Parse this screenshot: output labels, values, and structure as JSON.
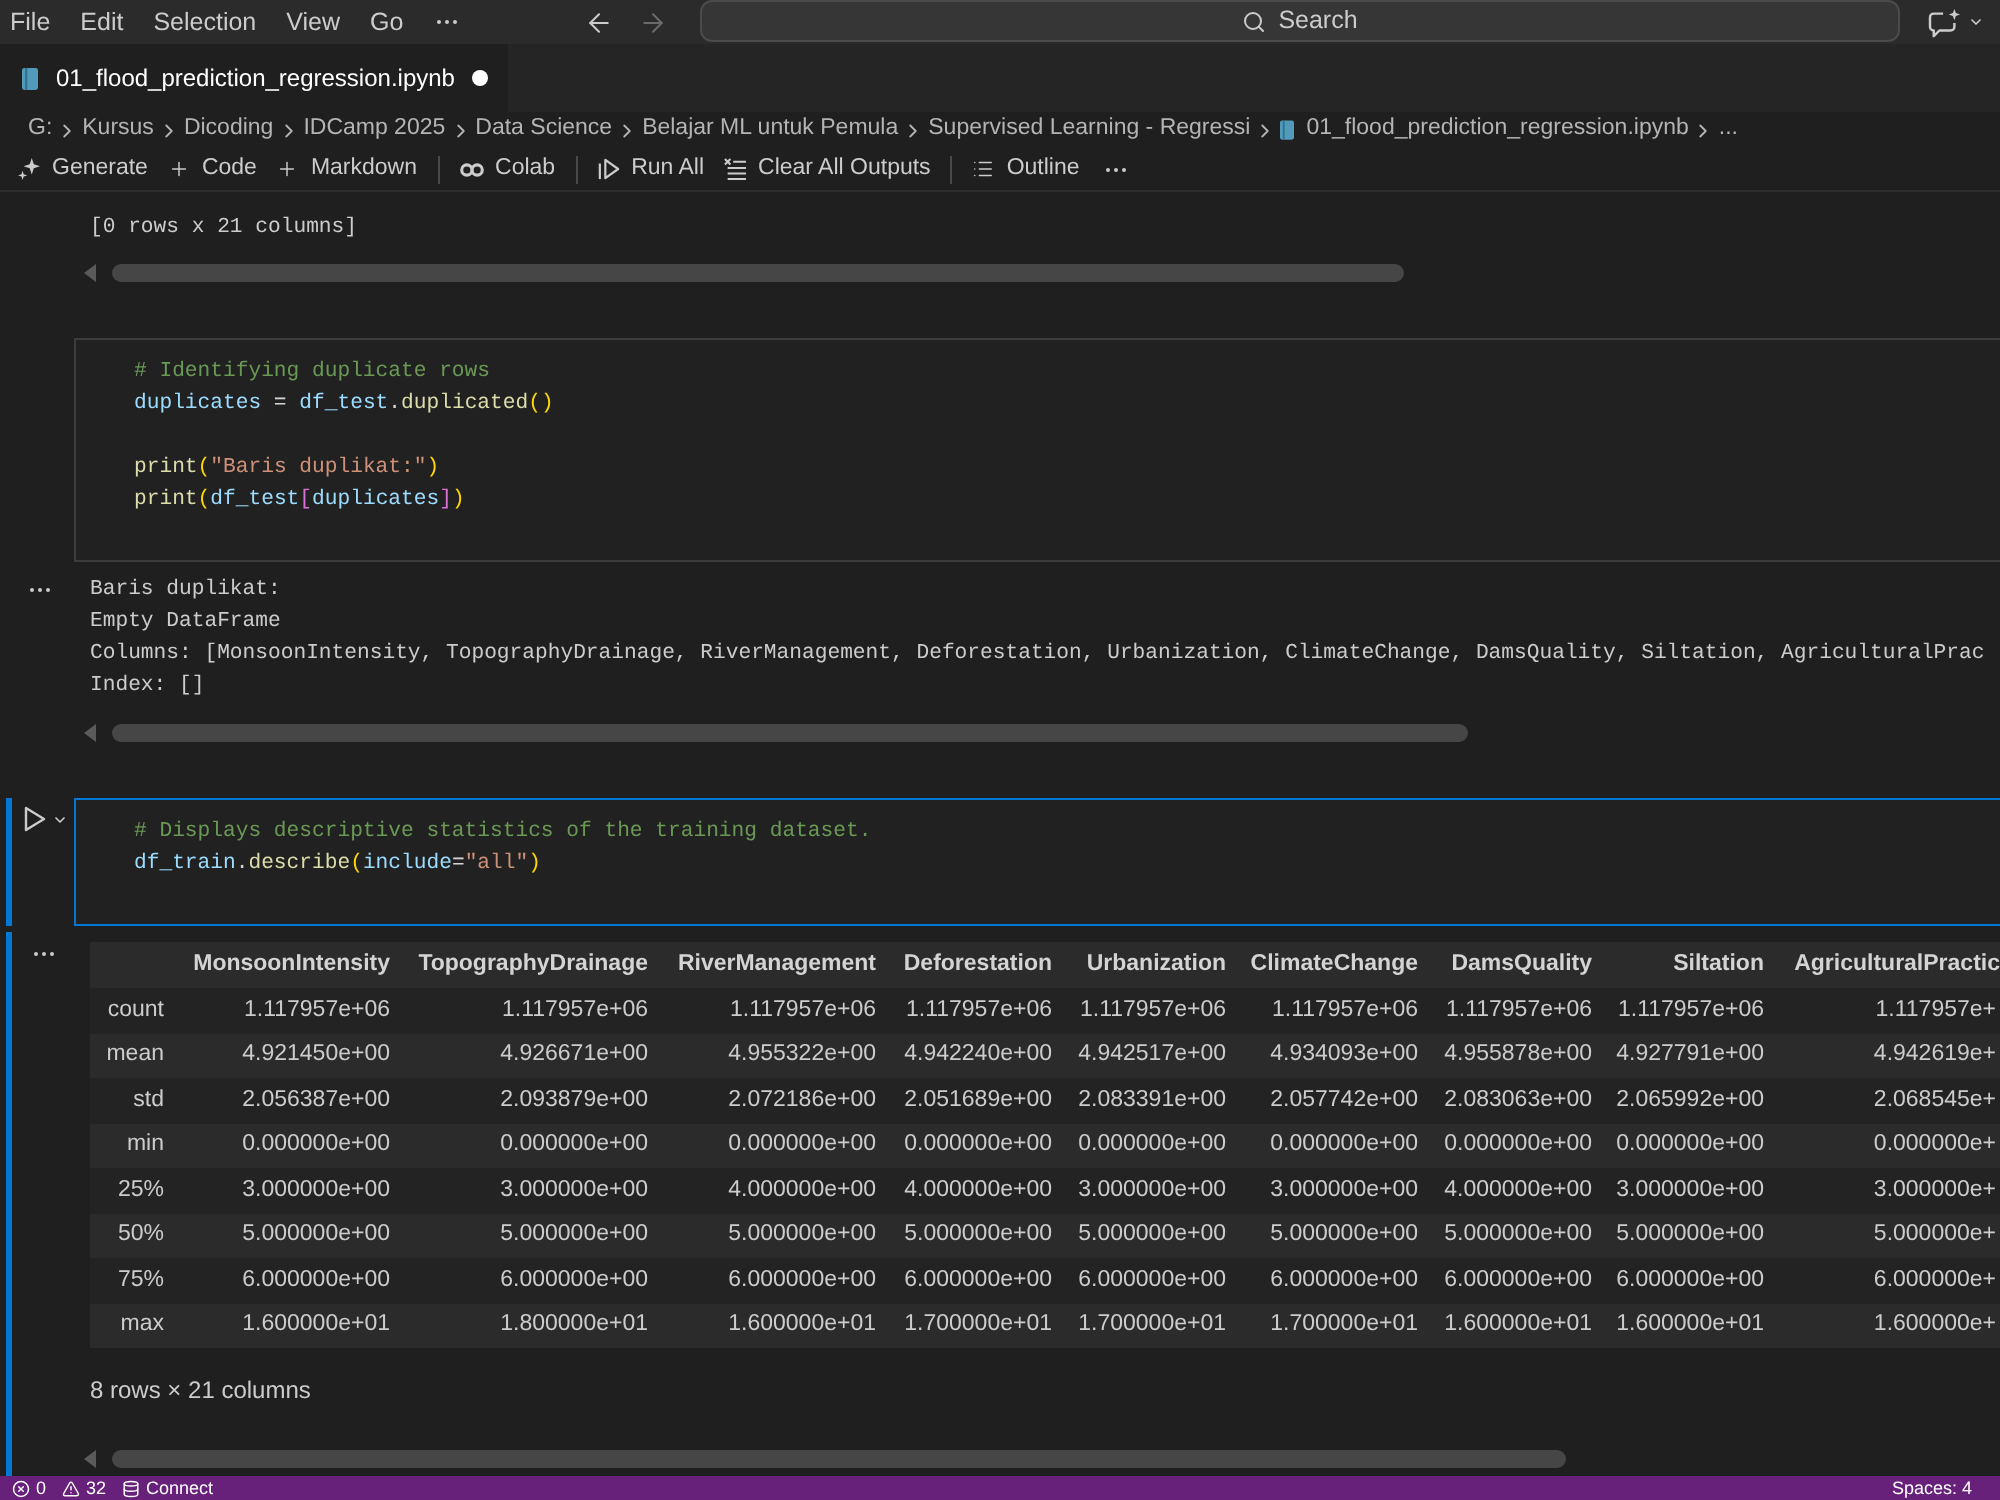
{
  "menubar": {
    "items": [
      "File",
      "Edit",
      "Selection",
      "View",
      "Go"
    ],
    "nav": [
      {
        "kind": "back",
        "disabled": false
      },
      {
        "kind": "forward",
        "disabled": true
      }
    ],
    "search": {
      "placeholder": "Search"
    }
  },
  "tabs": [
    {
      "title": "01_flood_prediction_regression.ipynb",
      "selected": true,
      "modified": true
    }
  ],
  "breadcrumb": [
    {
      "label": "G:",
      "kind": "path"
    },
    {
      "label": "Kursus",
      "kind": "path"
    },
    {
      "label": "Dicoding",
      "kind": "path"
    },
    {
      "label": "IDCamp 2025",
      "kind": "path"
    },
    {
      "label": "Data Science",
      "kind": "path"
    },
    {
      "label": "Belajar ML untuk Pemula",
      "kind": "path"
    },
    {
      "label": "Supervised Learning - Regressi",
      "kind": "path"
    },
    {
      "label": "01_flood_prediction_regression.ipynb",
      "kind": "file"
    },
    {
      "label": "...",
      "kind": "more"
    }
  ],
  "toolbar": [
    {
      "label": "Generate",
      "kind": "generate"
    },
    {
      "label": "Code",
      "kind": "add"
    },
    {
      "label": "Markdown",
      "kind": "add"
    },
    {
      "kind": "separator"
    },
    {
      "label": "Colab",
      "kind": "colab"
    },
    {
      "kind": "separator"
    },
    {
      "label": "Run All",
      "kind": "run_all"
    },
    {
      "label": "Clear All Outputs",
      "kind": "clear"
    },
    {
      "kind": "separator"
    },
    {
      "label": "Outline",
      "kind": "outline"
    },
    {
      "kind": "more"
    }
  ],
  "notebook": {
    "previous_output": [
      "[0 rows x 21 columns]"
    ],
    "cells": [
      {
        "selected": false,
        "code": [
          {
            "kind": "code",
            "tokens": [
              {
                "kind": "comment",
                "text": "# Identifying duplicate rows"
              }
            ]
          },
          {
            "kind": "code",
            "tokens": [
              {
                "kind": "variable",
                "text": "duplicates"
              },
              {
                "kind": "operator",
                "text": " = "
              },
              {
                "kind": "variable",
                "text": "df_test"
              },
              {
                "kind": "operator",
                "text": "."
              },
              {
                "kind": "function",
                "text": "duplicated"
              },
              {
                "kind": "paren",
                "text": "()"
              }
            ]
          },
          {
            "kind": "blank"
          },
          {
            "kind": "code",
            "tokens": [
              {
                "kind": "function",
                "text": "print"
              },
              {
                "kind": "paren",
                "text": "("
              },
              {
                "kind": "string",
                "text": "\"Baris duplikat:\""
              },
              {
                "kind": "paren",
                "text": ")"
              }
            ]
          },
          {
            "kind": "code",
            "tokens": [
              {
                "kind": "function",
                "text": "print"
              },
              {
                "kind": "paren",
                "text": "("
              },
              {
                "kind": "variable",
                "text": "df_test"
              },
              {
                "kind": "bracket",
                "text": "["
              },
              {
                "kind": "variable",
                "text": "duplicates"
              },
              {
                "kind": "bracket",
                "text": "]"
              },
              {
                "kind": "paren",
                "text": ")"
              }
            ]
          }
        ],
        "output": {
          "kind": "text",
          "lines": [
            "Baris duplikat:",
            "Empty DataFrame",
            "Columns: [MonsoonIntensity, TopographyDrainage, RiverManagement, Deforestation, Urbanization, ClimateChange, DamsQuality, Siltation, AgriculturalPrac",
            "Index: []"
          ]
        }
      },
      {
        "selected": true,
        "code": [
          {
            "kind": "code",
            "tokens": [
              {
                "kind": "comment",
                "text": "# Displays descriptive statistics of the training dataset."
              }
            ]
          },
          {
            "kind": "code",
            "tokens": [
              {
                "kind": "variable",
                "text": "df_train"
              },
              {
                "kind": "operator",
                "text": "."
              },
              {
                "kind": "function",
                "text": "describe"
              },
              {
                "kind": "paren",
                "text": "("
              },
              {
                "kind": "variable",
                "text": "include"
              },
              {
                "kind": "operator",
                "text": "="
              },
              {
                "kind": "string",
                "text": "\"all\""
              },
              {
                "kind": "paren",
                "text": ")"
              }
            ]
          }
        ],
        "output": {
          "kind": "table",
          "columns": [
            "MonsoonIntensity",
            "TopographyDrainage",
            "RiverManagement",
            "Deforestation",
            "Urbanization",
            "ClimateChange",
            "DamsQuality",
            "Siltation",
            "AgriculturalPractic"
          ],
          "rows": [
            {
              "index": "count",
              "values": [
                "1.117957e+06",
                "1.117957e+06",
                "1.117957e+06",
                "1.117957e+06",
                "1.117957e+06",
                "1.117957e+06",
                "1.117957e+06",
                "1.117957e+06",
                "1.117957e+"
              ]
            },
            {
              "index": "mean",
              "values": [
                "4.921450e+00",
                "4.926671e+00",
                "4.955322e+00",
                "4.942240e+00",
                "4.942517e+00",
                "4.934093e+00",
                "4.955878e+00",
                "4.927791e+00",
                "4.942619e+"
              ]
            },
            {
              "index": "std",
              "values": [
                "2.056387e+00",
                "2.093879e+00",
                "2.072186e+00",
                "2.051689e+00",
                "2.083391e+00",
                "2.057742e+00",
                "2.083063e+00",
                "2.065992e+00",
                "2.068545e+"
              ]
            },
            {
              "index": "min",
              "values": [
                "0.000000e+00",
                "0.000000e+00",
                "0.000000e+00",
                "0.000000e+00",
                "0.000000e+00",
                "0.000000e+00",
                "0.000000e+00",
                "0.000000e+00",
                "0.000000e+"
              ]
            },
            {
              "index": "25%",
              "values": [
                "3.000000e+00",
                "3.000000e+00",
                "4.000000e+00",
                "4.000000e+00",
                "3.000000e+00",
                "3.000000e+00",
                "4.000000e+00",
                "3.000000e+00",
                "3.000000e+"
              ]
            },
            {
              "index": "50%",
              "values": [
                "5.000000e+00",
                "5.000000e+00",
                "5.000000e+00",
                "5.000000e+00",
                "5.000000e+00",
                "5.000000e+00",
                "5.000000e+00",
                "5.000000e+00",
                "5.000000e+"
              ]
            },
            {
              "index": "75%",
              "values": [
                "6.000000e+00",
                "6.000000e+00",
                "6.000000e+00",
                "6.000000e+00",
                "6.000000e+00",
                "6.000000e+00",
                "6.000000e+00",
                "6.000000e+00",
                "6.000000e+"
              ]
            },
            {
              "index": "max",
              "values": [
                "1.600000e+01",
                "1.800000e+01",
                "1.600000e+01",
                "1.700000e+01",
                "1.700000e+01",
                "1.700000e+01",
                "1.600000e+01",
                "1.600000e+01",
                "1.600000e+"
              ]
            }
          ],
          "footer": "8 rows × 21 columns"
        }
      }
    ]
  },
  "status_bar": {
    "items": [
      {
        "kind": "errors",
        "label": "0"
      },
      {
        "kind": "warnings",
        "label": "32"
      },
      {
        "kind": "kernel",
        "label": "Connect"
      }
    ],
    "right": [
      "Spaces: 4"
    ]
  }
}
